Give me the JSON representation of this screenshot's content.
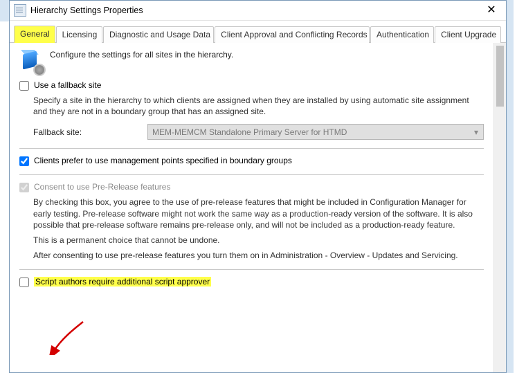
{
  "window": {
    "title": "Hierarchy Settings Properties"
  },
  "tabs": [
    {
      "label": "General"
    },
    {
      "label": "Licensing"
    },
    {
      "label": "Diagnostic and Usage Data"
    },
    {
      "label": "Client Approval and Conflicting Records"
    },
    {
      "label": "Authentication"
    },
    {
      "label": "Client Upgrade"
    }
  ],
  "intro": "Configure the settings for all sites in the hierarchy.",
  "fallback": {
    "checkbox_label": "Use a fallback site",
    "desc": "Specify a site in the hierarchy to which clients are assigned when they are installed by using automatic site assignment and they are not in a boundary group that has an assigned site.",
    "field_label": "Fallback site:",
    "selected_value": "MEM-MEMCM Standalone Primary Server for HTMD"
  },
  "boundary": {
    "label": "Clients prefer to use management points specified in boundary groups"
  },
  "prerelease": {
    "label": "Consent to use Pre-Release features",
    "para1": "By checking this box, you agree to the use of pre-release features that might be included in Configuration Manager for early testing. Pre-release software might not work the same way as a production-ready version of the software. It is also possible that pre-release software remains pre-release only, and will not be included as a production-ready feature.",
    "para2": "This is a permanent choice that cannot be undone.",
    "para3": "After consenting to use pre-release features you turn them on in Administration - Overview - Updates and Servicing."
  },
  "script_approver": {
    "label": "Script authors require additional script approver"
  }
}
